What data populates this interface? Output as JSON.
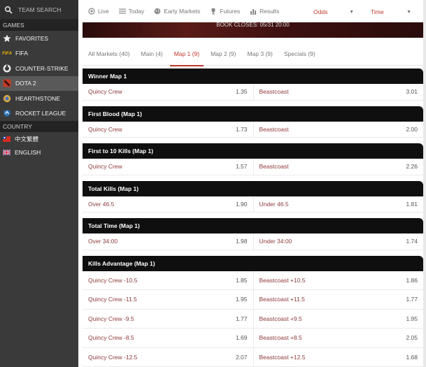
{
  "sidebar": {
    "search_placeholder": "TEAM SEARCH",
    "games_header": "GAMES",
    "games": [
      {
        "label": "FAVORITES",
        "icon": "star-icon"
      },
      {
        "label": "FIFA",
        "icon": "fifa-icon"
      },
      {
        "label": "COUNTER-STRIKE",
        "icon": "counter-strike-icon"
      },
      {
        "label": "DOTA 2",
        "icon": "dota2-icon",
        "active": true
      },
      {
        "label": "HEARTHSTONE",
        "icon": "hearthstone-icon"
      },
      {
        "label": "ROCKET LEAGUE",
        "icon": "rocket-league-icon"
      }
    ],
    "country_header": "COUNTRY",
    "languages": [
      {
        "label": "中文繁體",
        "icon": "taiwan-flag-icon"
      },
      {
        "label": "ENGLISH",
        "icon": "uk-flag-icon"
      }
    ]
  },
  "topnav": {
    "items": [
      {
        "label": "Live",
        "icon": "live-icon"
      },
      {
        "label": "Today",
        "icon": "list-icon"
      },
      {
        "label": "Early Markets",
        "icon": "globe-icon"
      },
      {
        "label": "Futures",
        "icon": "trophy-icon"
      },
      {
        "label": "Results",
        "icon": "bar-chart-icon"
      }
    ],
    "odds_select": "Odds",
    "time_select": "Time"
  },
  "banner": {
    "text": "BOOK CLOSES: 05/31 20:00"
  },
  "tabs": [
    {
      "label": "All Markets (40)"
    },
    {
      "label": "Main (4)"
    },
    {
      "label": "Map 1 (9)",
      "active": true
    },
    {
      "label": "Map 2 (9)"
    },
    {
      "label": "Map 3 (9)"
    },
    {
      "label": "Specials (9)"
    }
  ],
  "markets": [
    {
      "title": "Winner Map 1",
      "rows": [
        {
          "left": "Quincy Crew",
          "left_odds": "1.35",
          "right": "Beastcoast",
          "right_odds": "3.01"
        }
      ]
    },
    {
      "title": "First Blood (Map 1)",
      "rows": [
        {
          "left": "Quincy Crew",
          "left_odds": "1.73",
          "right": "Beastcoast",
          "right_odds": "2.00"
        }
      ]
    },
    {
      "title": "First to 10 Kills (Map 1)",
      "rows": [
        {
          "left": "Quincy Crew",
          "left_odds": "1.57",
          "right": "Beastcoast",
          "right_odds": "2.26"
        }
      ]
    },
    {
      "title": "Total Kills (Map 1)",
      "rows": [
        {
          "left": "Over 46.5",
          "left_odds": "1.90",
          "right": "Under 46.5",
          "right_odds": "1.81"
        }
      ]
    },
    {
      "title": "Total Time (Map 1)",
      "rows": [
        {
          "left": "Over 34:00",
          "left_odds": "1.98",
          "right": "Under 34:00",
          "right_odds": "1.74"
        }
      ]
    },
    {
      "title": "Kills Advantage (Map 1)",
      "rows": [
        {
          "left": "Quincy Crew -10.5",
          "left_odds": "1.85",
          "right": "Beastcoast +10.5",
          "right_odds": "1.86"
        },
        {
          "left": "Quincy Crew -11.5",
          "left_odds": "1.95",
          "right": "Beastcoast +11.5",
          "right_odds": "1.77"
        },
        {
          "left": "Quincy Crew -9.5",
          "left_odds": "1.77",
          "right": "Beastcoast +9.5",
          "right_odds": "1.95"
        },
        {
          "left": "Quincy Crew -8.5",
          "left_odds": "1.69",
          "right": "Beastcoast +8.5",
          "right_odds": "2.05"
        },
        {
          "left": "Quincy Crew -12.5",
          "left_odds": "2.07",
          "right": "Beastcoast +12.5",
          "right_odds": "1.68"
        }
      ]
    }
  ],
  "colors": {
    "accent": "#c0392b",
    "selection_text": "#8e3a3a",
    "header_bg": "#0f0f0f",
    "sidebar_bg": "#3a3a3a"
  }
}
